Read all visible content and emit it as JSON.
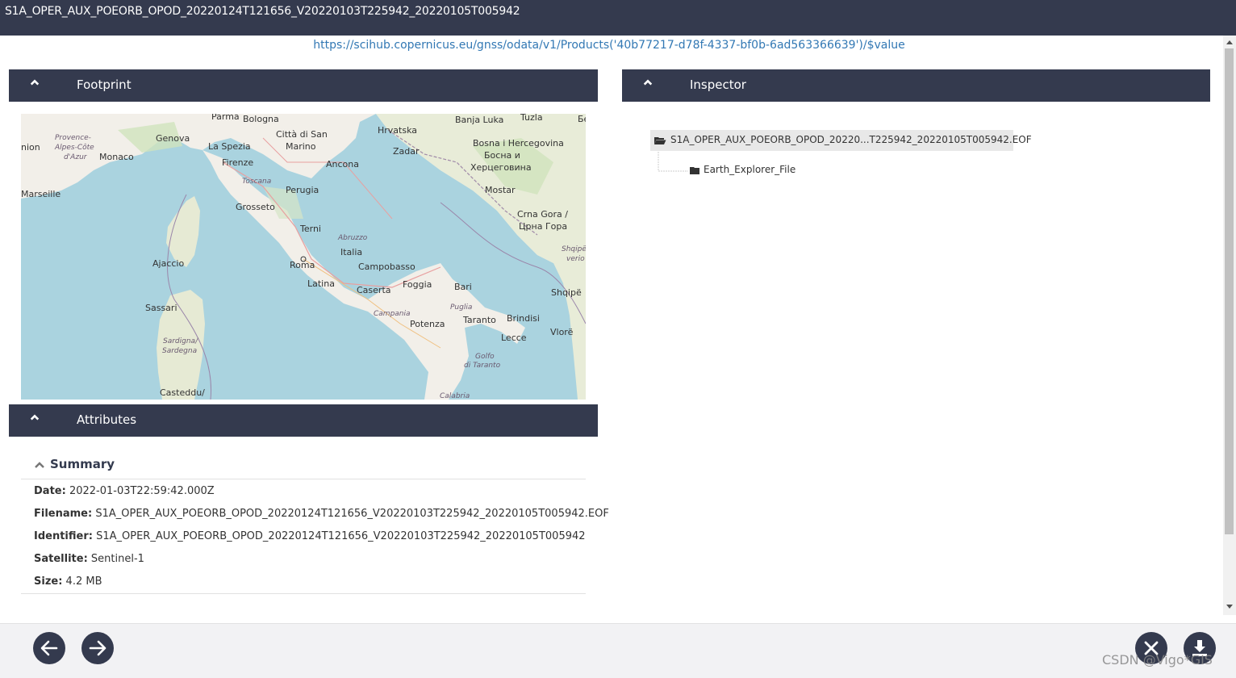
{
  "window": {
    "title": "S1A_OPER_AUX_POEORB_OPOD_20220124T121656_V20220103T225942_20220105T005942"
  },
  "download_url": "https://scihub.copernicus.eu/gnss/odata/v1/Products('40b77217-d78f-4337-bf0b-6ad563366639')/$value",
  "panels": {
    "footprint": {
      "title": "Footprint"
    },
    "attributes": {
      "title": "Attributes"
    },
    "inspector": {
      "title": "Inspector"
    }
  },
  "map": {
    "labels": [
      "Parma",
      "Bologna",
      "Città di San",
      "Marino",
      "Hrvatska",
      "Banja Luka",
      "Tuzla",
      "Бе",
      "Provence-",
      "Alpes-Côte",
      "d'Azur",
      "Monaco",
      "Genova",
      "La Spezia",
      "Firenze",
      "Ancona",
      "Zadar",
      "Bosna i Hercegovina",
      "Босна и",
      "Херцеговина",
      "nion",
      "Marseille",
      "Toscana",
      "Perugia",
      "Grosseto",
      "Mostar",
      "Crna Gora /",
      "Црна Гора",
      "Terni",
      "Abruzzo",
      "Shqipë",
      "verio",
      "Italia",
      "Ajaccio",
      "Roma",
      "Campobasso",
      "Latina",
      "Foggia",
      "Bari",
      "Shqipë",
      "Caserta",
      "Puglia",
      "Brindisi",
      "Sassari",
      "Campania",
      "Taranto",
      "Potenza",
      "Lecce",
      "Vlorë",
      "Golfo",
      "di Taranto",
      "Sardigna/",
      "Sardegna",
      "Casteddu/",
      "Calabria"
    ]
  },
  "summary": {
    "title": "Summary",
    "date_label": "Date:",
    "date_value": "2022-01-03T22:59:42.000Z",
    "filename_label": "Filename:",
    "filename_value": "S1A_OPER_AUX_POEORB_OPOD_20220124T121656_V20220103T225942_20220105T005942.EOF",
    "identifier_label": "Identifier:",
    "identifier_value": "S1A_OPER_AUX_POEORB_OPOD_20220124T121656_V20220103T225942_20220105T005942",
    "satellite_label": "Satellite:",
    "satellite_value": "Sentinel-1",
    "size_label": "Size:",
    "size_value": "4.2 MB"
  },
  "inspector": {
    "root_label": "S1A_OPER_AUX_POEORB_OPOD_20220...T225942_20220105T005942.EOF",
    "child_label": "Earth_Explorer_File"
  },
  "watermark": "CSDN @Vigo*GIS",
  "colors": {
    "header_bg": "#343a4e",
    "link": "#3278b4",
    "sea": "#aad3df",
    "land": "#f2efe9"
  }
}
